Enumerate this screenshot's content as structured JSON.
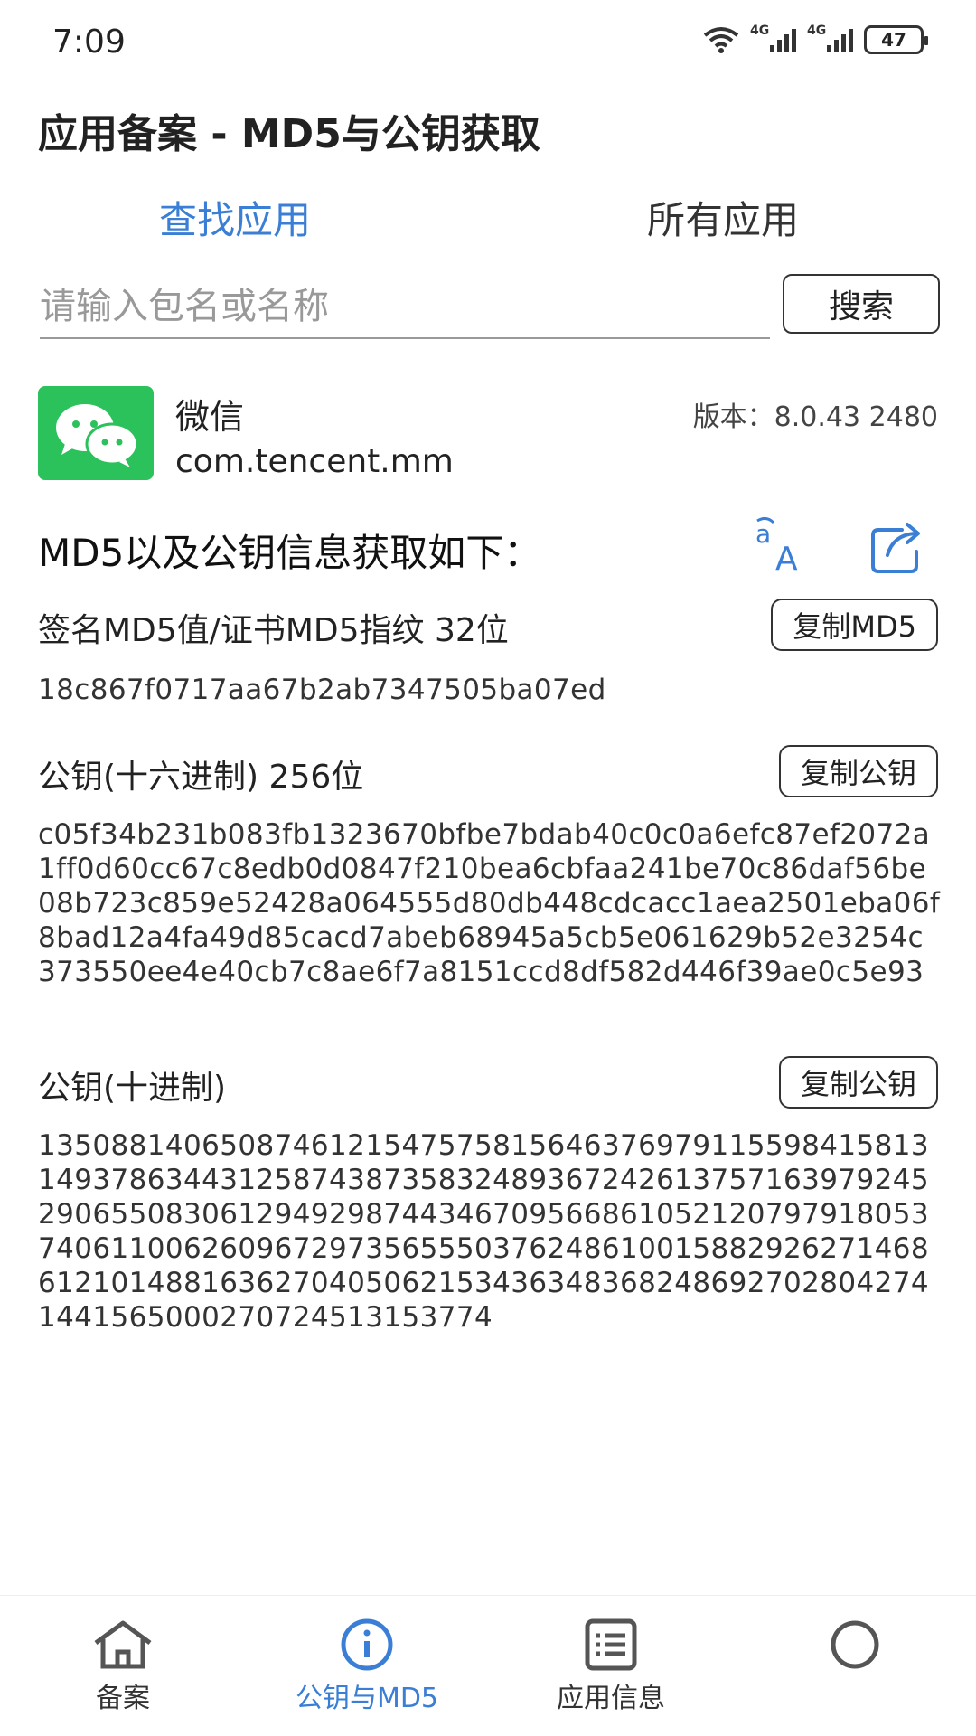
{
  "status_bar": {
    "time": "7:09",
    "net1": "4G",
    "net2": "4G",
    "battery": "47"
  },
  "header": {
    "title": "应用备案 - MD5与公钥获取"
  },
  "tabs": [
    {
      "label": "查找应用",
      "active": true
    },
    {
      "label": "所有应用",
      "active": false
    }
  ],
  "search": {
    "placeholder": "请输入包名或名称",
    "value": "",
    "button_label": "搜索"
  },
  "app": {
    "name": "微信",
    "package": "com.tencent.mm",
    "version": "版本：8.0.43   2480",
    "icon": "wechat-icon"
  },
  "info": {
    "heading": "MD5以及公钥信息获取如下：",
    "translate_icon": "translate-icon",
    "share_icon": "share-icon"
  },
  "md5": {
    "label": "签名MD5值/证书MD5指纹   32位",
    "copy_label": "复制MD5",
    "value": "18c867f0717aa67b2ab7347505ba07ed"
  },
  "pubkey_hex": {
    "label": "公钥(十六进制)   256位",
    "copy_label": "复制公钥",
    "value": "c05f34b231b083fb1323670bfbe7bdab40c0c0a6efc87ef2072a1ff0d60cc67c8edb0d0847f210bea6cbfaa241be70c86daf56be08b723c859e52428a064555d80db448cdcacc1aea2501eba06f8bad12a4fa49d85cacd7abeb68945a5cb5e061629b52e3254c373550ee4e40cb7c8ae6f7a8151ccd8df582d446f39ae0c5e93"
  },
  "pubkey_dec": {
    "label": "公钥(十进制)",
    "copy_label": "复制公钥",
    "value": "135088140650874612154757581564637697911559841581314937863443125874387358324893672426137571639792452906550830612949298744346709566861052120797918053740611006260967297356555037624861001588292627146861210148816362704050621534363483682486927028042741441565000270724513153774"
  },
  "bottom_nav": [
    {
      "label": "备案",
      "icon": "home-icon",
      "active": false
    },
    {
      "label": "公钥与MD5",
      "icon": "info-icon",
      "active": true
    },
    {
      "label": "应用信息",
      "icon": "list-icon",
      "active": false
    },
    {
      "label": "",
      "icon": "search-icon",
      "active": false
    }
  ],
  "colors": {
    "accent": "#3a7fd5",
    "wechat_green": "#2bc15b",
    "text": "#222222"
  }
}
